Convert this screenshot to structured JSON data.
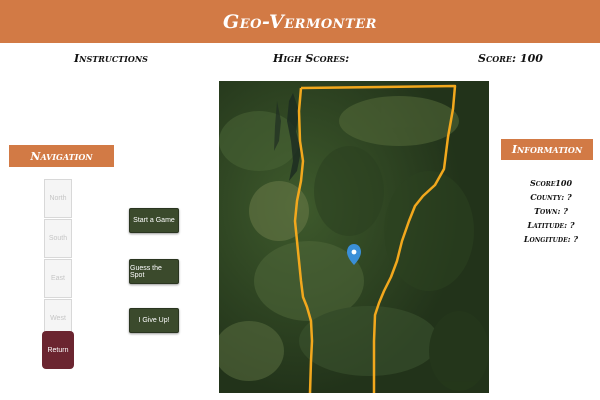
{
  "header": {
    "title": "Geo-Vermonter"
  },
  "topbar": {
    "instructions": "Instructions",
    "high_scores": "High Scores:",
    "score": "Score: 100"
  },
  "navigation": {
    "title": "Navigation",
    "buttons": [
      "North",
      "South",
      "East",
      "West"
    ],
    "return_label": "Return"
  },
  "actions": {
    "start": "Start a Game",
    "guess": "Guess the Spot",
    "give_up": "I Give Up!"
  },
  "map": {
    "marker_icon": "map-pin-icon",
    "border_color": "#f2a81d",
    "marker_color": "#3a8fd8"
  },
  "information": {
    "title": "Information",
    "score": "Score100",
    "county": "County: ?",
    "town": "Town: ?",
    "latitude": "Latitude: ?",
    "longitude": "Longitude: ?"
  },
  "colors": {
    "accent": "#d27a45",
    "return_button": "#6b2530",
    "action_button": "#3b4a2c"
  }
}
